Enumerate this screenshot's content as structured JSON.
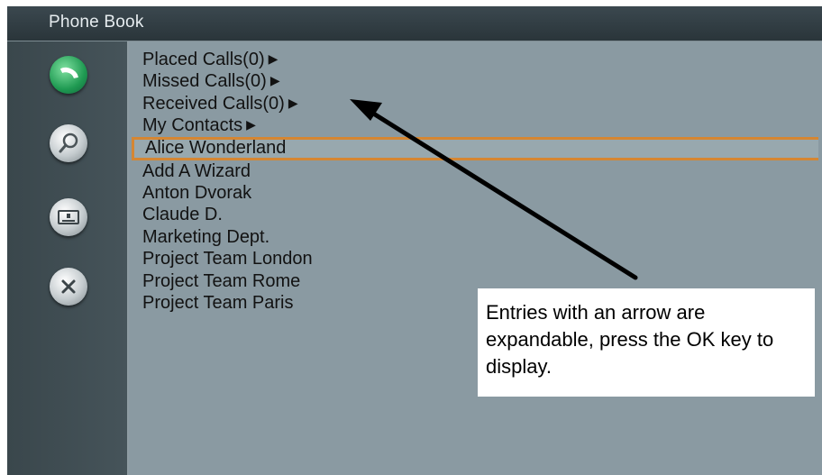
{
  "header": {
    "title": "Phone Book"
  },
  "sidebar": {
    "icons": [
      {
        "name": "call-icon",
        "color": "#2aa05a"
      },
      {
        "name": "search-icon",
        "color": "#c7cdd0"
      },
      {
        "name": "contact-card-icon",
        "color": "#c7cdd0"
      },
      {
        "name": "close-icon",
        "color": "#c7cdd0"
      }
    ]
  },
  "list": {
    "items": [
      {
        "label": "Placed Calls(0)",
        "arrow": "▶"
      },
      {
        "label": "Missed Calls(0)",
        "arrow": "▶"
      },
      {
        "label": "Received Calls(0)",
        "arrow": "▶"
      },
      {
        "label": "My Contacts",
        "arrow": "▶"
      },
      {
        "label": "Alice Wonderland",
        "arrow": "",
        "selected": true
      },
      {
        "label": "Add A Wizard",
        "arrow": ""
      },
      {
        "label": "Anton Dvorak",
        "arrow": ""
      },
      {
        "label": "Claude D.",
        "arrow": ""
      },
      {
        "label": "Marketing Dept.",
        "arrow": ""
      },
      {
        "label": "Project Team London",
        "arrow": ""
      },
      {
        "label": "Project Team Rome",
        "arrow": ""
      },
      {
        "label": "Project Team Paris",
        "arrow": ""
      }
    ]
  },
  "annotation": {
    "text": "Entries with an arrow are expandable, press the OK key to display."
  },
  "colors": {
    "selection_border": "#d58632",
    "panel_background": "#8a9aa2",
    "sidebar_background": "#3f4d52"
  }
}
